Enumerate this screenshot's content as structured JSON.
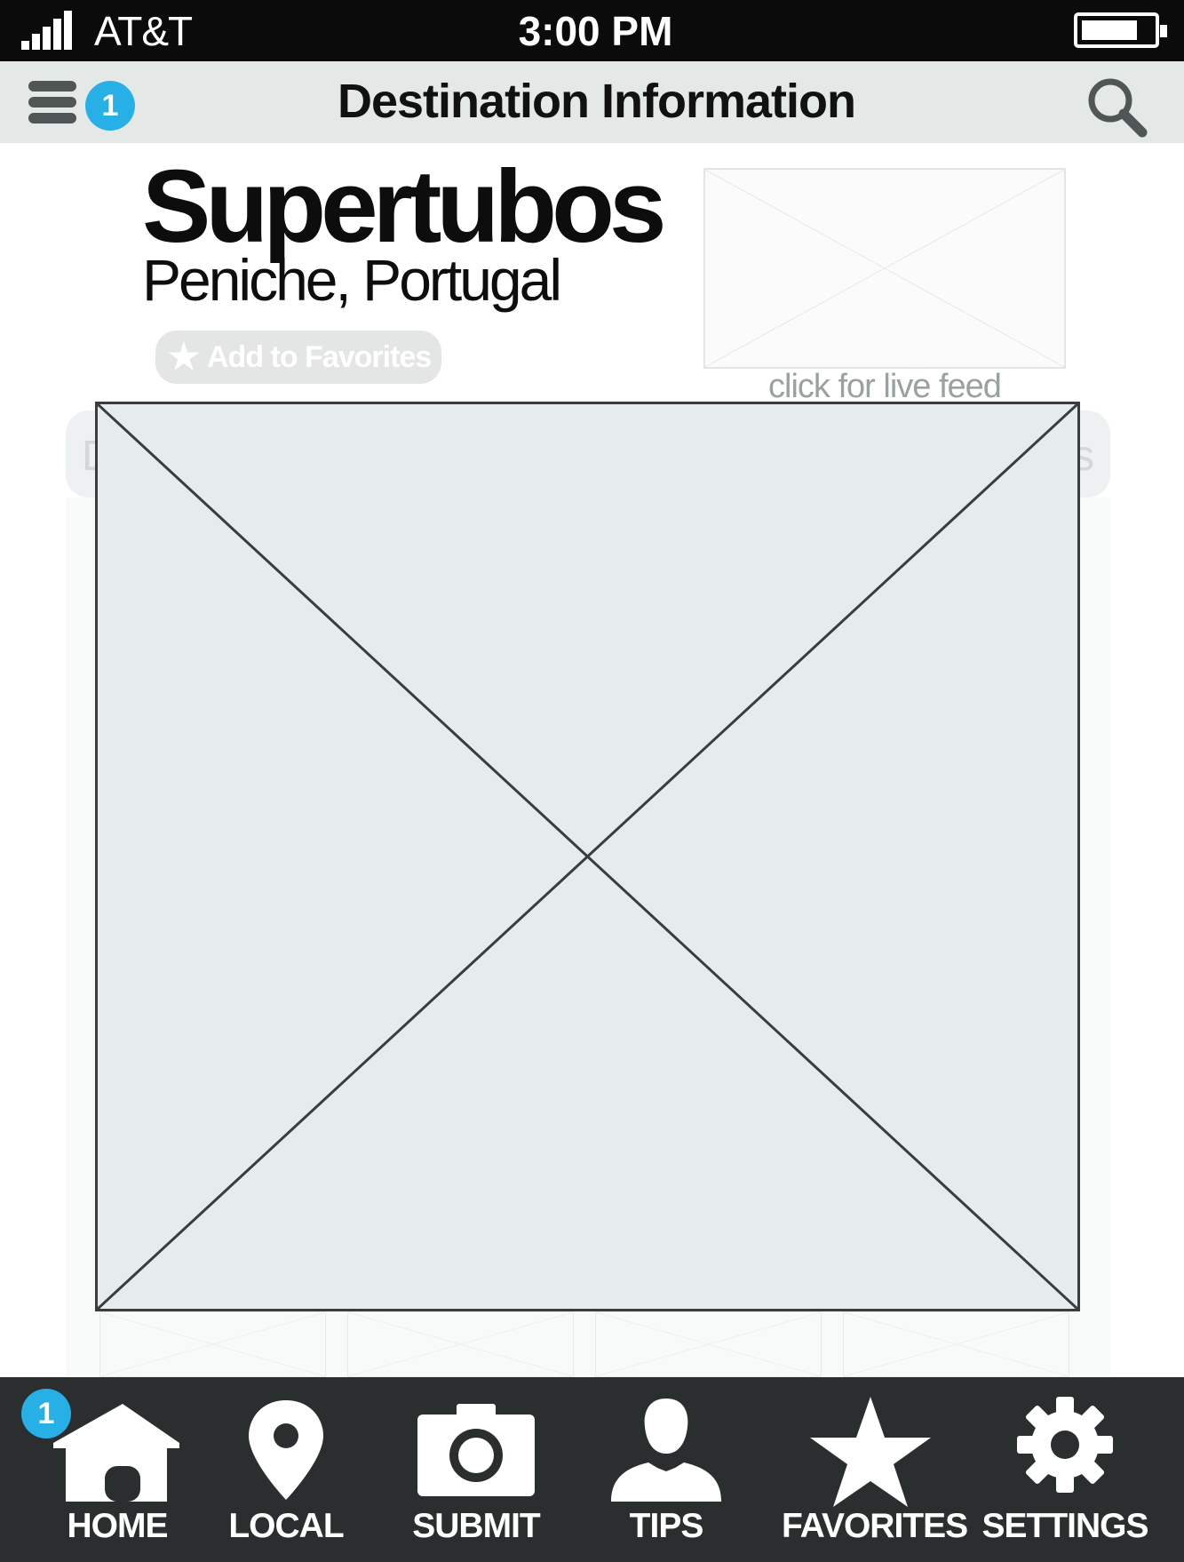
{
  "status_bar": {
    "carrier": "AT&T",
    "time": "3:00 PM",
    "signal_bars": 5,
    "battery_level": 0.75
  },
  "nav_bar": {
    "title": "Destination Information",
    "notification_count": "1",
    "menu_icon": "hamburger-menu-icon",
    "search_icon": "search-icon"
  },
  "destination": {
    "name": "Supertubos",
    "location": "Peniche, Portugal",
    "favorite_button_label": "Add to Favorites",
    "live_feed_caption": "click for live feed"
  },
  "tab_bar": {
    "badge_count": "1",
    "tabs": [
      {
        "label": "HOME",
        "icon": "home-icon"
      },
      {
        "label": "LOCAL",
        "icon": "map-pin-icon"
      },
      {
        "label": "SUBMIT",
        "icon": "camera-icon"
      },
      {
        "label": "TIPS",
        "icon": "person-icon"
      },
      {
        "label": "FAVORITES",
        "icon": "star-icon"
      },
      {
        "label": "SETTINGS",
        "icon": "gear-icon"
      }
    ]
  },
  "colors": {
    "badge": "#27b0e6",
    "navbar_bg": "#e4e9e8",
    "tabbar_bg": "#2b2e2f",
    "placeholder_bg": "#e6ecec"
  }
}
